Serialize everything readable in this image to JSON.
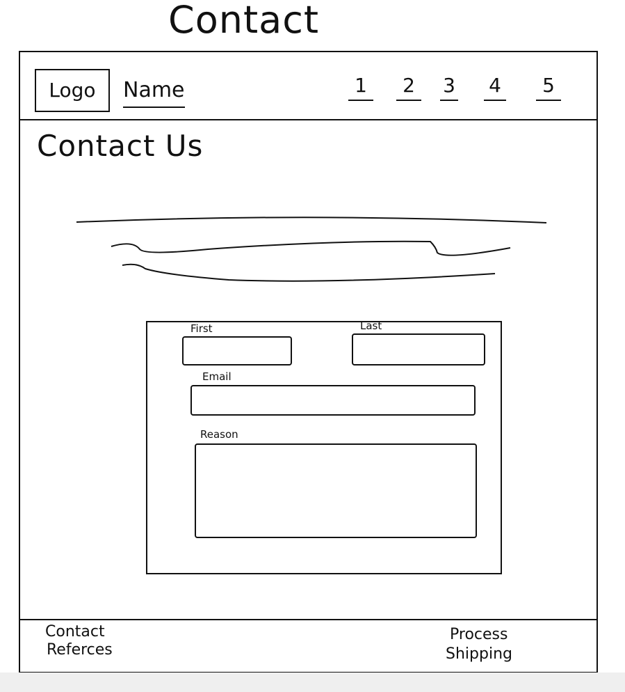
{
  "page": {
    "title": "Contact"
  },
  "header": {
    "logo": "Logo",
    "name": "Name",
    "nav": [
      "1",
      "2",
      "3",
      "4",
      "5"
    ]
  },
  "main": {
    "heading": "Contact Us"
  },
  "form": {
    "first_label": "First",
    "last_label": "Last",
    "email_label": "Email",
    "reason_label": "Reason"
  },
  "footer": {
    "left_links": [
      "Contact",
      "Referces"
    ],
    "right_links": [
      "Process",
      "Shipping"
    ]
  },
  "colors": {
    "ink": "#111111",
    "paper": "#ffffff",
    "strip": "#efefef"
  }
}
